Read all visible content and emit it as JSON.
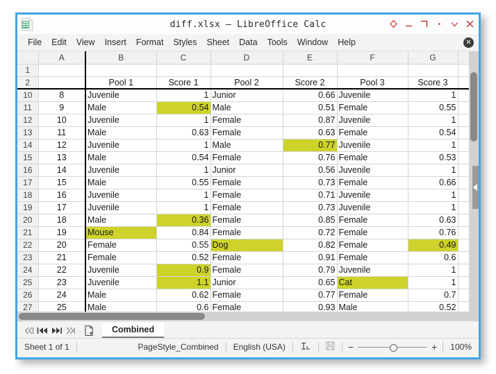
{
  "window": {
    "title": "diff.xlsx – LibreOffice Calc",
    "app_icon": "calc-document-icon",
    "controls": [
      {
        "name": "shade-button",
        "glyph": "diamond"
      },
      {
        "name": "minimize-button",
        "glyph": "minimize"
      },
      {
        "name": "maximize-button",
        "glyph": "maximize"
      },
      {
        "name": "dot-button",
        "glyph": "dot"
      },
      {
        "name": "rollup-button",
        "glyph": "chevron-down"
      },
      {
        "name": "close-button",
        "glyph": "close"
      }
    ],
    "accent_color": "#41a5e8",
    "control_color": "#c0392b"
  },
  "menubar": {
    "items": [
      "File",
      "Edit",
      "View",
      "Insert",
      "Format",
      "Styles",
      "Sheet",
      "Data",
      "Tools",
      "Window",
      "Help"
    ],
    "close_document_label": "✕"
  },
  "sheet": {
    "columns": [
      "A",
      "B",
      "C",
      "D",
      "E",
      "F",
      "G",
      ""
    ],
    "header_row_number": "2",
    "headers": [
      "",
      "Pool 1",
      "Score 1",
      "Pool 2",
      "Score 2",
      "Pool 3",
      "Score 3",
      ""
    ],
    "blank_row_number": "1",
    "highlight_color": "#cdd32a",
    "rows": [
      {
        "n": "10",
        "a": "8",
        "b": "Juvenile",
        "c": "1",
        "d": "Junior",
        "e": "0.66",
        "f": "Juvenile",
        "g": "1",
        "hl": []
      },
      {
        "n": "11",
        "a": "9",
        "b": "Male",
        "c": "0.54",
        "d": "Male",
        "e": "0.51",
        "f": "Female",
        "g": "0.55",
        "hl": [
          "c"
        ]
      },
      {
        "n": "12",
        "a": "10",
        "b": "Juvenile",
        "c": "1",
        "d": "Female",
        "e": "0.87",
        "f": "Juvenile",
        "g": "1",
        "hl": []
      },
      {
        "n": "13",
        "a": "11",
        "b": "Male",
        "c": "0.63",
        "d": "Female",
        "e": "0.63",
        "f": "Female",
        "g": "0.54",
        "hl": []
      },
      {
        "n": "14",
        "a": "12",
        "b": "Juvenile",
        "c": "1",
        "d": "Male",
        "e": "0.77",
        "f": "Juvenile",
        "g": "1",
        "hl": [
          "e"
        ]
      },
      {
        "n": "15",
        "a": "13",
        "b": "Male",
        "c": "0.54",
        "d": "Female",
        "e": "0.76",
        "f": "Female",
        "g": "0.53",
        "hl": []
      },
      {
        "n": "16",
        "a": "14",
        "b": "Juvenile",
        "c": "1",
        "d": "Junior",
        "e": "0.56",
        "f": "Juvenile",
        "g": "1",
        "hl": []
      },
      {
        "n": "17",
        "a": "15",
        "b": "Male",
        "c": "0.55",
        "d": "Female",
        "e": "0.73",
        "f": "Female",
        "g": "0.66",
        "hl": []
      },
      {
        "n": "18",
        "a": "16",
        "b": "Juvenile",
        "c": "1",
        "d": "Female",
        "e": "0.71",
        "f": "Juvenile",
        "g": "1",
        "hl": []
      },
      {
        "n": "19",
        "a": "17",
        "b": "Juvenile",
        "c": "1",
        "d": "Female",
        "e": "0.73",
        "f": "Juvenile",
        "g": "1",
        "hl": []
      },
      {
        "n": "20",
        "a": "18",
        "b": "Male",
        "c": "0.36",
        "d": "Female",
        "e": "0.85",
        "f": "Female",
        "g": "0.63",
        "hl": [
          "c"
        ]
      },
      {
        "n": "21",
        "a": "19",
        "b": "Mouse",
        "c": "0.84",
        "d": "Female",
        "e": "0.72",
        "f": "Female",
        "g": "0.76",
        "hl": [
          "b"
        ]
      },
      {
        "n": "22",
        "a": "20",
        "b": "Female",
        "c": "0.55",
        "d": "Dog",
        "e": "0.82",
        "f": "Female",
        "g": "0.49",
        "hl": [
          "d",
          "g"
        ]
      },
      {
        "n": "23",
        "a": "21",
        "b": "Female",
        "c": "0.52",
        "d": "Female",
        "e": "0.91",
        "f": "Female",
        "g": "0.6",
        "hl": []
      },
      {
        "n": "24",
        "a": "22",
        "b": "Juvenile",
        "c": "0.9",
        "d": "Female",
        "e": "0.79",
        "f": "Juvenile",
        "g": "1",
        "hl": [
          "c"
        ]
      },
      {
        "n": "25",
        "a": "23",
        "b": "Juvenile",
        "c": "1.1",
        "d": "Junior",
        "e": "0.65",
        "f": "Cat",
        "g": "1",
        "hl": [
          "c",
          "f"
        ]
      },
      {
        "n": "26",
        "a": "24",
        "b": "Male",
        "c": "0.62",
        "d": "Female",
        "e": "0.77",
        "f": "Female",
        "g": "0.7",
        "hl": []
      },
      {
        "n": "27",
        "a": "25",
        "b": "Male",
        "c": "0.6",
        "d": "Female",
        "e": "0.93",
        "f": "Male",
        "g": "0.52",
        "hl": []
      }
    ]
  },
  "tabbar": {
    "nav": [
      {
        "name": "first-sheet-button",
        "glyph": "≪|"
      },
      {
        "name": "previous-sheet-button",
        "glyph": "|◀◀"
      },
      {
        "name": "next-sheet-button",
        "glyph": "▶▶|"
      },
      {
        "name": "last-sheet-button",
        "glyph": "|≫"
      }
    ],
    "add_sheet_label": "add-sheet-icon",
    "tabs": [
      {
        "label": "Combined",
        "active": true
      }
    ]
  },
  "statusbar": {
    "sheet_count": "Sheet 1 of 1",
    "page_style": "PageStyle_Combined",
    "language": "English (USA)",
    "insert_mode_icon": "text-insert-mode-icon",
    "save_state_icon": "document-saved-icon",
    "zoom_out_label": "−",
    "zoom_in_label": "+",
    "zoom_level": "100%"
  }
}
